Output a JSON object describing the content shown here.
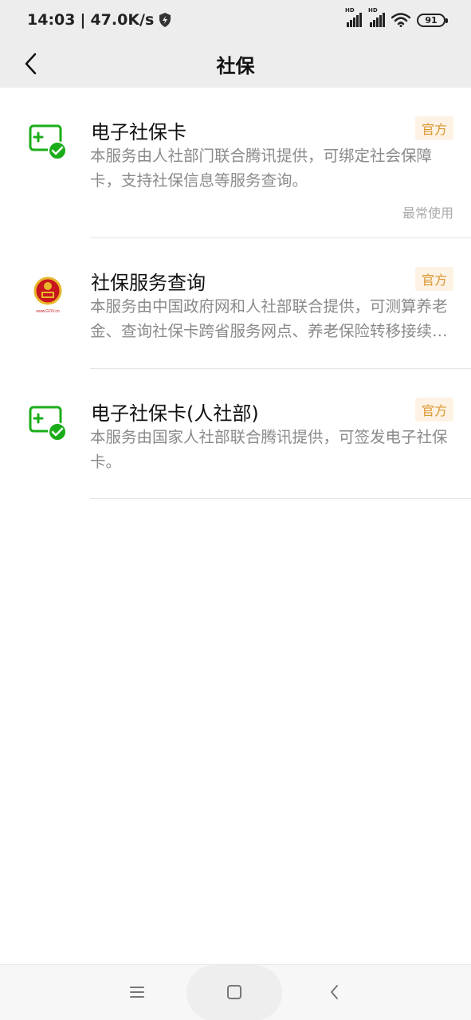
{
  "status_bar": {
    "time": "14:03",
    "net_speed": "47.0K/s",
    "battery": "91",
    "sim_label": "HD",
    "icons": [
      "shield-icon",
      "signal-icon",
      "signal-icon",
      "wifi-icon",
      "battery-icon"
    ]
  },
  "header": {
    "title": "社保",
    "back_icon": "chevron-left-icon"
  },
  "services": [
    {
      "title": "电子社保卡",
      "badge": "官方",
      "description": "本服务由人社部门联合腾讯提供，可绑定社会保障卡，支持社保信息等服务查询。",
      "usage_tag": "最常使用",
      "icon": "e-card-wechat-icon"
    },
    {
      "title": "社保服务查询",
      "badge": "官方",
      "description": "本服务由中国政府网和人社部联合提供，可测算养老金、查询社保卡跨省服务网点、养老保险转移接续经办机构等服务。",
      "icon": "national-emblem-icon",
      "icon_caption": "www.GOV.cn"
    },
    {
      "title": "电子社保卡(人社部)",
      "badge": "官方",
      "description": "本服务由国家人社部联合腾讯提供，可签发电子社保卡。",
      "icon": "e-card-wechat-icon"
    }
  ],
  "colors": {
    "accent_green": "#1aad19",
    "badge_text": "#d9962e",
    "badge_bg": "#fdf2e3",
    "header_bg": "#ededed"
  },
  "bottom_nav": {
    "icons": [
      "menu-icon",
      "home-icon",
      "back-icon"
    ]
  }
}
